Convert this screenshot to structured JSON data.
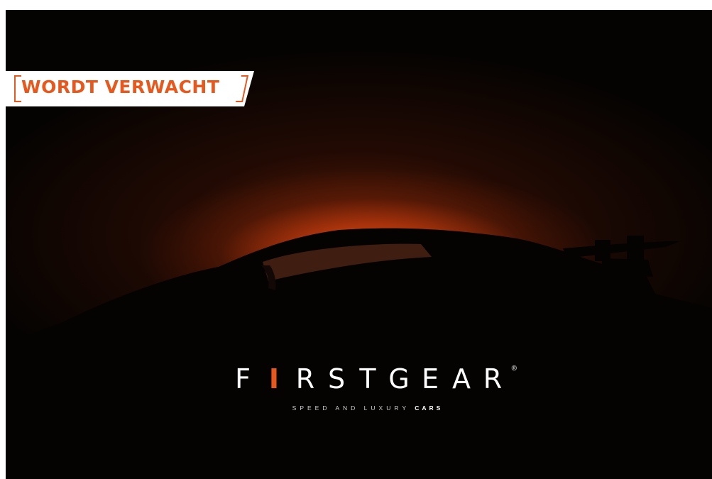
{
  "badge": {
    "label": "WORDT VERWACHT"
  },
  "logo": {
    "letters": [
      "F",
      "I",
      "R",
      "S",
      "T",
      "G",
      "E",
      "A",
      "R"
    ],
    "accent_letter_index": 1,
    "registered": "®",
    "tagline_main": "SPEED AND LUXURY",
    "tagline_accent": "CARS"
  },
  "colors": {
    "accent": "#e8571b",
    "background": "#050302",
    "glow": "#ec5214"
  }
}
